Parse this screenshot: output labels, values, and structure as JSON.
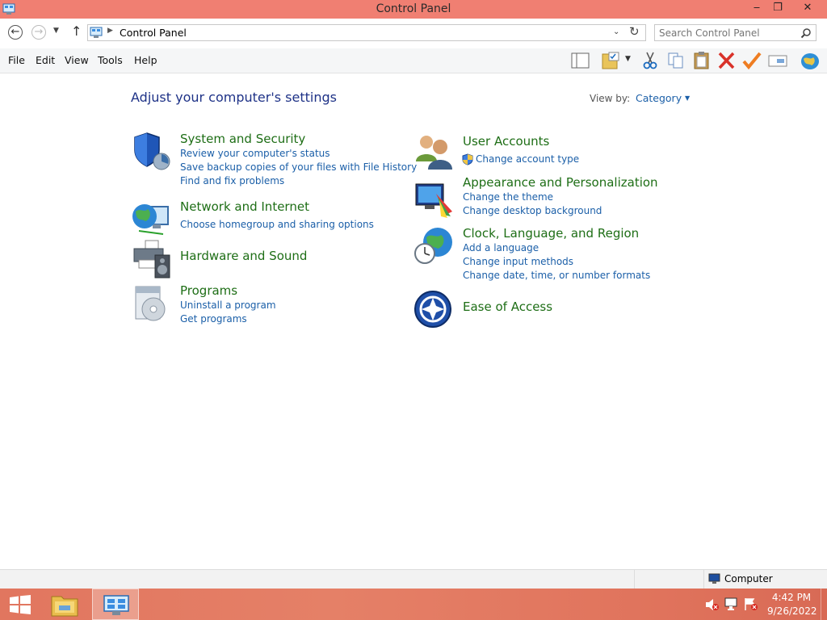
{
  "window": {
    "title": "Control Panel",
    "minimize": "‒",
    "maximize": "❐",
    "close": "✕"
  },
  "address_bar": {
    "path": "Control Panel",
    "search_placeholder": "Search Control Panel"
  },
  "menu": [
    "File",
    "Edit",
    "View",
    "Tools",
    "Help"
  ],
  "toolbar_icons": [
    "layout-pane-icon",
    "folder-check-icon",
    "cut-icon",
    "copy-icon",
    "paste-icon",
    "delete-icon",
    "checkmark-icon",
    "rename-icon",
    "globe-icon"
  ],
  "content": {
    "heading": "Adjust your computer's settings",
    "view_by_label": "View by:",
    "view_by_value": "Category",
    "categories": [
      {
        "title": "System and Security",
        "icon": "shield-icon",
        "links": [
          "Review your computer's status",
          "Save backup copies of your files with File History",
          "Find and fix problems"
        ]
      },
      {
        "title": "Network and Internet",
        "icon": "network-globe-icon",
        "links": [
          "Choose homegroup and sharing options"
        ]
      },
      {
        "title": "Hardware and Sound",
        "icon": "printer-speaker-icon",
        "links": []
      },
      {
        "title": "Programs",
        "icon": "programs-disc-icon",
        "links": [
          "Uninstall a program",
          "Get programs"
        ]
      },
      {
        "title": "User Accounts",
        "icon": "users-icon",
        "links": [
          "Change account type"
        ]
      },
      {
        "title": "Appearance and Personalization",
        "icon": "monitor-palette-icon",
        "links": [
          "Change the theme",
          "Change desktop background"
        ]
      },
      {
        "title": "Clock, Language, and Region",
        "icon": "clock-globe-icon",
        "links": [
          "Add a language",
          "Change input methods",
          "Change date, time, or number formats"
        ]
      },
      {
        "title": "Ease of Access",
        "icon": "ease-of-access-icon",
        "links": []
      }
    ]
  },
  "status_bar": {
    "location": "Computer"
  },
  "taskbar": {
    "time": "4:42 PM",
    "date": "9/26/2022"
  },
  "colors": {
    "title_bar": "#f07f72",
    "category_title": "#1e6e16",
    "link": "#1b5fa8",
    "heading": "#1e3287",
    "taskbar": "#e58067"
  }
}
